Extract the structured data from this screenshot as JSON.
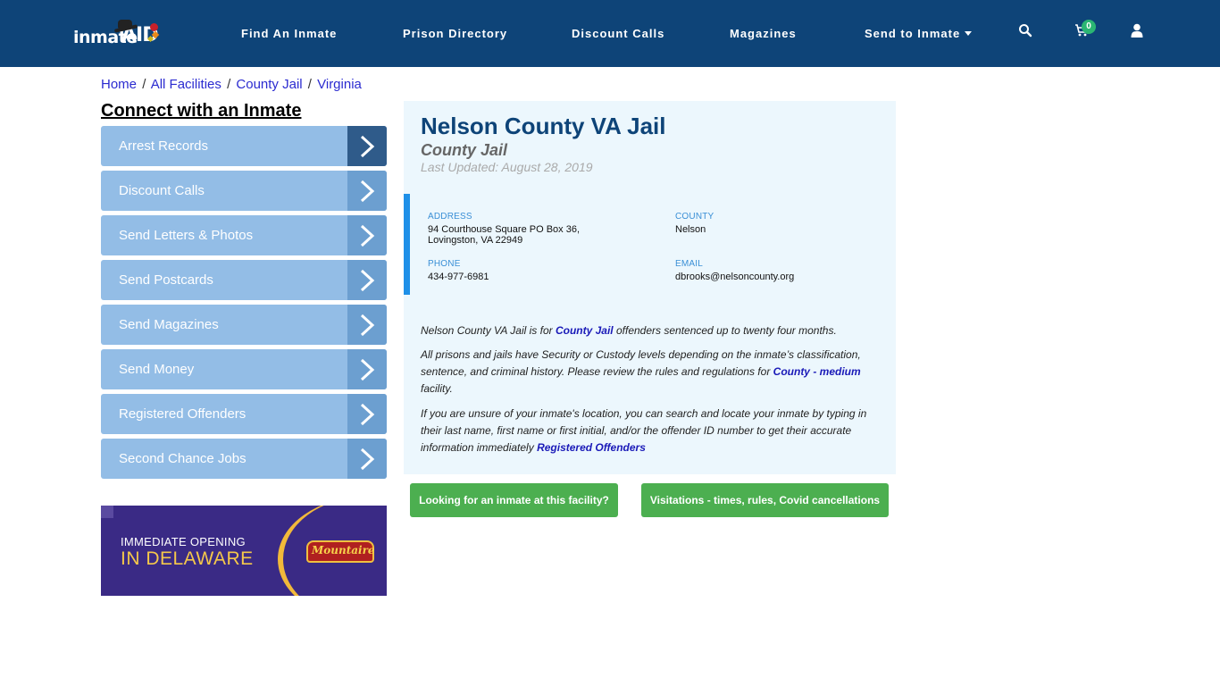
{
  "header": {
    "logo_text": "inmate",
    "logo_aid": "AID",
    "nav": [
      {
        "label": "Find An Inmate"
      },
      {
        "label": "Prison Directory"
      },
      {
        "label": "Discount Calls"
      },
      {
        "label": "Magazines"
      },
      {
        "label": "Send to Inmate",
        "has_dropdown": true
      }
    ],
    "icons": [
      "search-icon",
      "cart-icon",
      "user-icon"
    ],
    "cart_count": "0",
    "colors": {
      "navbar": "#0e4478",
      "badge": "#2bb673"
    }
  },
  "breadcrumb": [
    {
      "label": "Home"
    },
    {
      "label": "All Facilities"
    },
    {
      "label": "County Jail"
    },
    {
      "label": "Virginia"
    }
  ],
  "breadcrumb_sep": "/",
  "sidebar": {
    "title": "Connect with an Inmate",
    "items": [
      {
        "label": "Arrest Records",
        "active": true
      },
      {
        "label": "Discount Calls"
      },
      {
        "label": "Send Letters & Photos"
      },
      {
        "label": "Send Postcards"
      },
      {
        "label": "Send Magazines"
      },
      {
        "label": "Send Money"
      },
      {
        "label": "Registered Offenders"
      },
      {
        "label": "Second Chance Jobs"
      }
    ],
    "ad": {
      "line1": "IMMEDIATE OPENING",
      "line2": "IN DELAWARE",
      "brand": "Mountaire"
    }
  },
  "facility": {
    "name": "Nelson County VA Jail",
    "type": "County Jail",
    "last_updated": "Last Updated: August 28, 2019",
    "address_label": "ADDRESS",
    "address_line1": "94 Courthouse Square PO Box 36,",
    "address_line2": "Lovingston, VA 22949",
    "county_label": "COUNTY",
    "county": "Nelson",
    "phone_label": "PHONE",
    "phone": "434-977-6981",
    "email_label": "EMAIL",
    "email": "dbrooks@nelsoncounty.org"
  },
  "description": {
    "p1_pre": "Nelson County VA Jail is for ",
    "p1_link": "County Jail",
    "p1_post": " offenders sentenced up to twenty four months.",
    "p2_pre": "All prisons and jails have Security or Custody levels depending on the inmate’s classification, sentence, and criminal history. Please review the rules and regulations for ",
    "p2_link": "County - medium",
    "p2_post": " facility.",
    "p3_pre": "If you are unsure of your inmate's location, you can search and locate your inmate by typing in their last name, first name or first initial, and/or the offender ID number to get their accurate information immediately ",
    "p3_link": "Registered Offenders"
  },
  "buttons": {
    "find_inmate": "Looking for an inmate at this facility?",
    "visitations": "Visitations - times, rules, Covid cancellations"
  }
}
